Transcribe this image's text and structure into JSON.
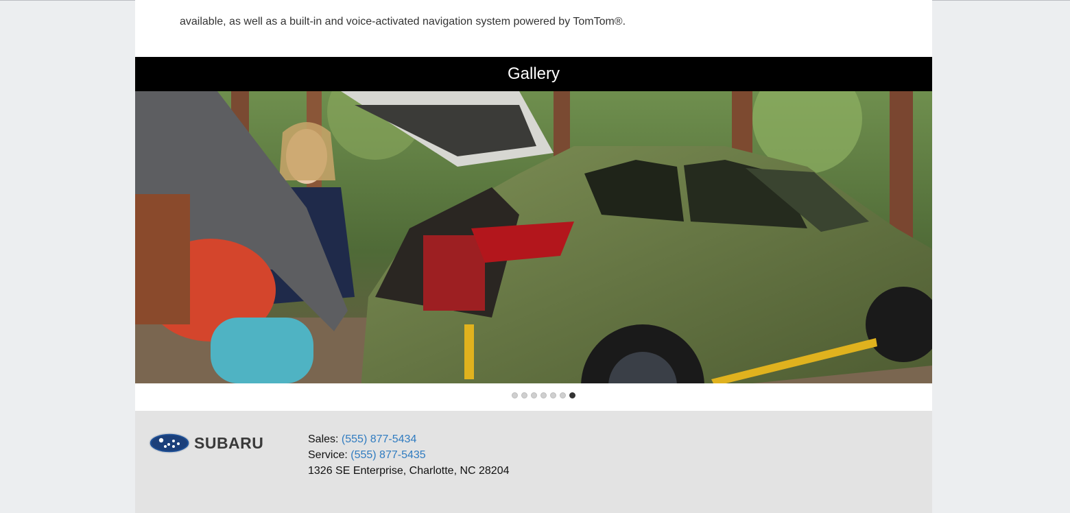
{
  "intro": {
    "text": "available, as well as a built-in and voice-activated navigation system powered by TomTom®."
  },
  "gallery": {
    "title": "Gallery",
    "slide_count": 7,
    "active_slide": 7
  },
  "footer": {
    "brand": "SUBARU",
    "sales_label": "Sales:",
    "sales_phone": "(555) 877-5434",
    "service_label": "Service:",
    "service_phone": "(555) 877-5435",
    "address": "1326 SE Enterprise, Charlotte, NC 28204"
  },
  "colors": {
    "link": "#2f7bc0",
    "gallery_bar": "#000000",
    "footer_bg": "#e3e3e3",
    "page_bg": "#eceef0"
  }
}
